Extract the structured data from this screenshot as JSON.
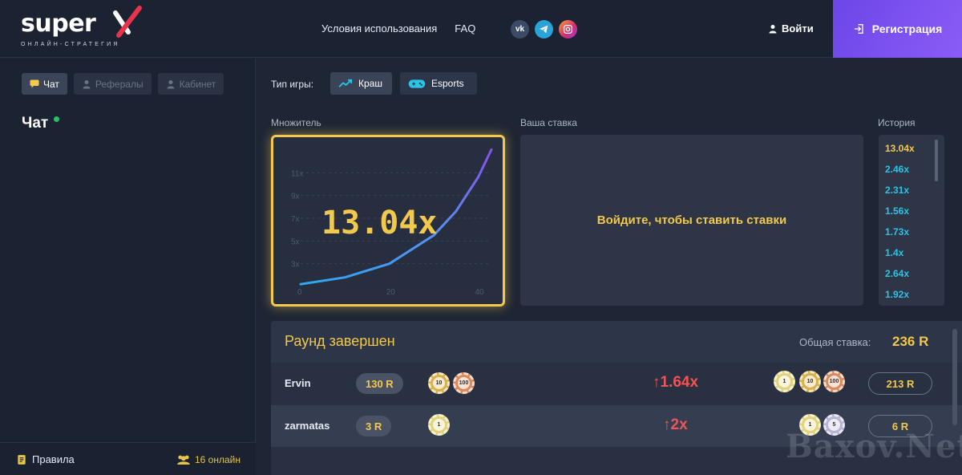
{
  "header": {
    "logo_text": "super",
    "logo_sub": "ОНЛАЙН-СТРАТЕГИЯ",
    "nav": {
      "terms": "Условия использования",
      "faq": "FAQ"
    },
    "socials": {
      "vk": "vk",
      "telegram": "tg",
      "instagram": "ig"
    },
    "login": "Войти",
    "register": "Регистрация"
  },
  "sidebar": {
    "tabs": {
      "chat": "Чат",
      "referrals": "Рефералы",
      "cabinet": "Кабинет"
    },
    "chat_title": "Чат",
    "footer": {
      "rules": "Правила",
      "online": "16 онлайн"
    }
  },
  "game": {
    "type_label": "Тип игры:",
    "type_crash": "Краш",
    "type_esports": "Esports",
    "multiplier_label": "Множитель",
    "bet_label": "Ваша ставка",
    "history_label": "История",
    "multiplier_value": "13.04x",
    "bet_message": "Войдите, чтобы ставить ставки",
    "history": [
      "13.04x",
      "2.46x",
      "2.31x",
      "1.56x",
      "1.73x",
      "1.4x",
      "2.64x",
      "1.92x"
    ],
    "history_colors": [
      "#f2c94c",
      "#29c5e6",
      "#29c5e6",
      "#29c5e6",
      "#29c5e6",
      "#29c5e6",
      "#29c5e6",
      "#29c5e6"
    ]
  },
  "chart_data": {
    "type": "line",
    "title": "",
    "x_ticks": [
      "0",
      "20",
      "40"
    ],
    "y_ticks": [
      "3x",
      "5x",
      "7x",
      "9x",
      "11x"
    ],
    "xlim": [
      0,
      43
    ],
    "ylim": [
      1,
      13
    ],
    "series": [
      {
        "name": "",
        "x": [
          0,
          10,
          20,
          30,
          35,
          40,
          43
        ],
        "y": [
          1.2,
          1.8,
          3.0,
          5.5,
          7.6,
          10.6,
          13.04
        ]
      }
    ]
  },
  "round": {
    "title": "Раунд завершен",
    "total_label": "Общая ставка:",
    "total_value": "236 R",
    "rows": [
      {
        "name": "Ervin",
        "bet": "130 R",
        "mult": "↑1.64x",
        "win": "213 R",
        "bet_chips": [
          "10",
          "100"
        ],
        "win_chips": [
          "1",
          "10",
          "100"
        ]
      },
      {
        "name": "zarmatas",
        "bet": "3 R",
        "mult": "↑2x",
        "win": "6 R",
        "bet_chips": [
          "1"
        ],
        "win_chips": [
          "1",
          "5"
        ]
      }
    ]
  },
  "watermark": "Baxov.Net"
}
